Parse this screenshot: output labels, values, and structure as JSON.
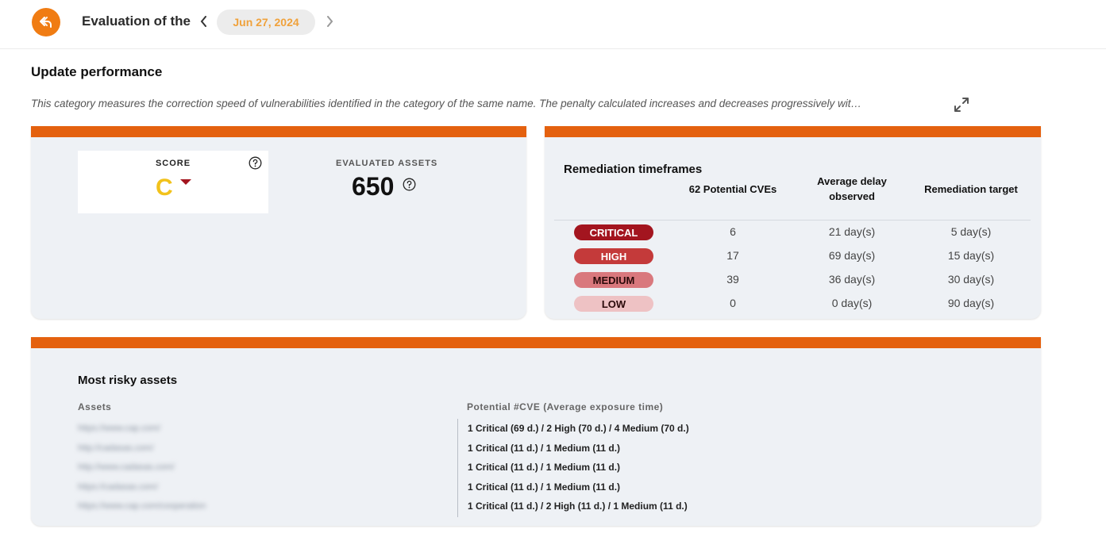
{
  "header": {
    "title": "Evaluation of the",
    "date": "Jun 27, 2024",
    "back_icon": "reply-arrow-icon",
    "accent": "#f07c13"
  },
  "section": {
    "title": "Update performance",
    "description": "This category measures the correction speed of vulnerabilities identified in the category of the same name. The penalty calculated increases and decreases progressively wit…"
  },
  "score_card": {
    "score_label": "SCORE",
    "grade": "C",
    "grade_color": "#f2c21b",
    "trend": "down",
    "trend_color": "#a3151f",
    "assets_label": "EVALUATED ASSETS",
    "assets_count": "650"
  },
  "remediation": {
    "title": "Remediation timeframes",
    "headers": [
      "62 Potential CVEs",
      "Average delay observed",
      "Remediation target"
    ],
    "rows": [
      {
        "severity": "CRITICAL",
        "count": "6",
        "avg": "21 day(s)",
        "target": "5 day(s)",
        "bg": "#a3151f",
        "fg": "#ffffff"
      },
      {
        "severity": "HIGH",
        "count": "17",
        "avg": "69 day(s)",
        "target": "15 day(s)",
        "bg": "#c43a3a",
        "fg": "#ffffff"
      },
      {
        "severity": "MEDIUM",
        "count": "39",
        "avg": "36 day(s)",
        "target": "30 day(s)",
        "bg": "#d9787d",
        "fg": "#2a0a0a"
      },
      {
        "severity": "LOW",
        "count": "0",
        "avg": "0 day(s)",
        "target": "90 day(s)",
        "bg": "#eec2c4",
        "fg": "#2a0a0a"
      }
    ]
  },
  "risky": {
    "title": "Most risky assets",
    "col_assets": "Assets",
    "col_cve": "Potential #CVE (Average exposure time)",
    "rows": [
      {
        "asset": "https://www.cap.com/",
        "cve": "1 Critical (69 d.) / 2 High (70 d.) / 4 Medium (70 d.)"
      },
      {
        "asset": "http://cadasas.com/",
        "cve": "1 Critical (11 d.) / 1 Medium (11 d.)"
      },
      {
        "asset": "http://www.cadasas.com/",
        "cve": "1 Critical (11 d.) / 1 Medium (11 d.)"
      },
      {
        "asset": "https://cadasas.com/",
        "cve": "1 Critical (11 d.) / 1 Medium (11 d.)"
      },
      {
        "asset": "https://www.cap.com/cooperation",
        "cve": "1 Critical (11 d.) / 2 High (11 d.) / 1 Medium (11 d.)"
      }
    ]
  }
}
